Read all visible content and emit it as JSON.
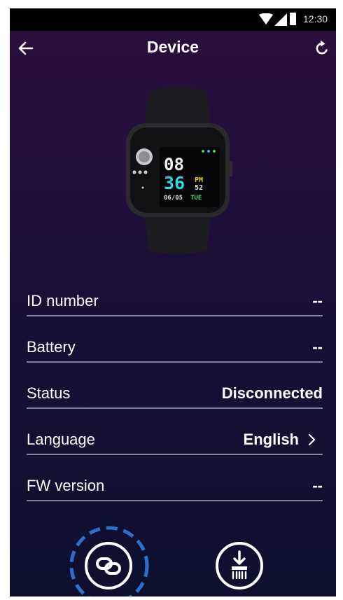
{
  "status_bar": {
    "time": "12:30",
    "icons": [
      "wifi-icon",
      "signal-icon",
      "battery-icon"
    ]
  },
  "header": {
    "title": "Device",
    "back_icon": "back-arrow-icon",
    "refresh_icon": "refresh-icon"
  },
  "watch_display": {
    "hour": "08",
    "minute": "36",
    "ampm": "PM",
    "seconds": "52",
    "date": "06/05",
    "day": "TUE"
  },
  "info_rows": [
    {
      "label": "ID number",
      "value": "--"
    },
    {
      "label": "Battery",
      "value": "--"
    },
    {
      "label": "Status",
      "value": "Disconnected"
    },
    {
      "label": "Language",
      "value": "English"
    },
    {
      "label": "FW version",
      "value": "--"
    }
  ],
  "actions": {
    "pair_icon": "link-pair-icon",
    "firmware_icon": "firmware-update-icon"
  },
  "colors": {
    "accent": "#2f6fc9",
    "background_top": "#2a0f3d",
    "background_bottom": "#0d1030",
    "divider": "#7f819a"
  }
}
